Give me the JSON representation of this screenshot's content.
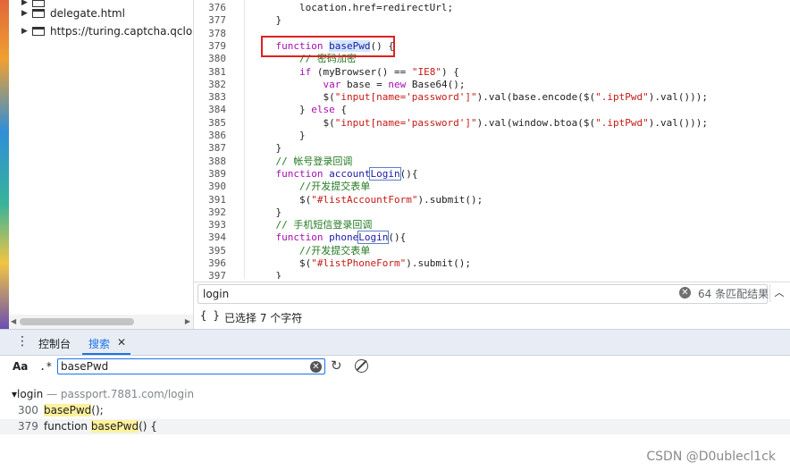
{
  "file_tree": {
    "items": [
      {
        "label": "delegate.html",
        "icon": "frame-icon"
      },
      {
        "label": "https://turing.captcha.qcloud.",
        "icon": "frame-icon"
      }
    ]
  },
  "editor": {
    "line_numbers": [
      "376",
      "377",
      "378",
      "379",
      "380",
      "381",
      "382",
      "383",
      "384",
      "385",
      "386",
      "387",
      "388",
      "389",
      "390",
      "391",
      "392",
      "393",
      "394",
      "395",
      "396",
      "397"
    ],
    "lines": [
      [
        {
          "t": "        location.href=redirectUrl;"
        }
      ],
      [
        {
          "t": "    }"
        }
      ],
      [
        {
          "t": ""
        }
      ],
      [
        {
          "t": "    "
        },
        {
          "t": "function",
          "c": "kw"
        },
        {
          "t": " "
        },
        {
          "t": "basePwd",
          "c": "fn hl"
        },
        {
          "t": "() {"
        }
      ],
      [
        {
          "t": "        "
        },
        {
          "t": "// 密码加密",
          "c": "cmt"
        }
      ],
      [
        {
          "t": "        "
        },
        {
          "t": "if",
          "c": "kw"
        },
        {
          "t": " (myBrowser() == "
        },
        {
          "t": "\"IE8\"",
          "c": "str"
        },
        {
          "t": ") {"
        }
      ],
      [
        {
          "t": "            "
        },
        {
          "t": "var",
          "c": "kw"
        },
        {
          "t": " base = "
        },
        {
          "t": "new",
          "c": "kw"
        },
        {
          "t": " Base64();"
        }
      ],
      [
        {
          "t": "            $("
        },
        {
          "t": "\"input[name='password']\"",
          "c": "str"
        },
        {
          "t": ").val(base.encode($("
        },
        {
          "t": "\".iptPwd\"",
          "c": "str"
        },
        {
          "t": ").val()));"
        }
      ],
      [
        {
          "t": "        } "
        },
        {
          "t": "else",
          "c": "kw"
        },
        {
          "t": " {"
        }
      ],
      [
        {
          "t": "            $("
        },
        {
          "t": "\"input[name='password']\"",
          "c": "str"
        },
        {
          "t": ").val(window.btoa($("
        },
        {
          "t": "\".iptPwd\"",
          "c": "str"
        },
        {
          "t": ").val()));"
        }
      ],
      [
        {
          "t": "        }"
        }
      ],
      [
        {
          "t": "    }"
        }
      ],
      [
        {
          "t": "    "
        },
        {
          "t": "// 帐号登录回调",
          "c": "cmt"
        }
      ],
      [
        {
          "t": "    "
        },
        {
          "t": "function",
          "c": "kw"
        },
        {
          "t": " "
        },
        {
          "t": "account",
          "c": "fn"
        },
        {
          "t": "Login",
          "c": "fn match"
        },
        {
          "t": "(){"
        }
      ],
      [
        {
          "t": "        "
        },
        {
          "t": "//开发提交表单",
          "c": "cmt"
        }
      ],
      [
        {
          "t": "        $("
        },
        {
          "t": "\"#listAccountForm\"",
          "c": "str"
        },
        {
          "t": ").submit();"
        }
      ],
      [
        {
          "t": "    }"
        }
      ],
      [
        {
          "t": "    "
        },
        {
          "t": "// 手机短信登录回调",
          "c": "cmt"
        }
      ],
      [
        {
          "t": "    "
        },
        {
          "t": "function",
          "c": "kw"
        },
        {
          "t": " "
        },
        {
          "t": "phone",
          "c": "fn"
        },
        {
          "t": "Login",
          "c": "fn match"
        },
        {
          "t": "(){"
        }
      ],
      [
        {
          "t": "        "
        },
        {
          "t": "//开发提交表单",
          "c": "cmt"
        }
      ],
      [
        {
          "t": "        $("
        },
        {
          "t": "\"#listPhoneForm\"",
          "c": "str"
        },
        {
          "t": ").submit();"
        }
      ],
      [
        {
          "t": "    }"
        }
      ]
    ]
  },
  "find_bar": {
    "query": "login",
    "count": "64 条匹配结果",
    "prev_icon": "chevron-up-icon"
  },
  "status_bar": {
    "braces": "{ }",
    "selection": "已选择 7 个字符"
  },
  "drawer": {
    "tabs": [
      {
        "label": "控制台"
      },
      {
        "label": "搜索"
      }
    ],
    "close": "✕"
  },
  "search": {
    "case_label": "Aa",
    "regex_label": ".*",
    "query": "basePwd",
    "refresh_icon": "refresh-icon",
    "cancel_icon": "cancel-icon"
  },
  "results": {
    "file": "login",
    "path": "— passport.7881.com/login",
    "rows": [
      {
        "num": "300",
        "before": "",
        "match": "basePwd",
        "after": "();"
      },
      {
        "num": "379",
        "before": "function ",
        "match": "basePwd",
        "after": "() {"
      }
    ]
  },
  "watermark": "CSDN @D0ublecl1ck",
  "colors": {
    "accent": "#1a73e8",
    "highlight_box": "#e02020",
    "match_bg": "#fdf29b"
  }
}
